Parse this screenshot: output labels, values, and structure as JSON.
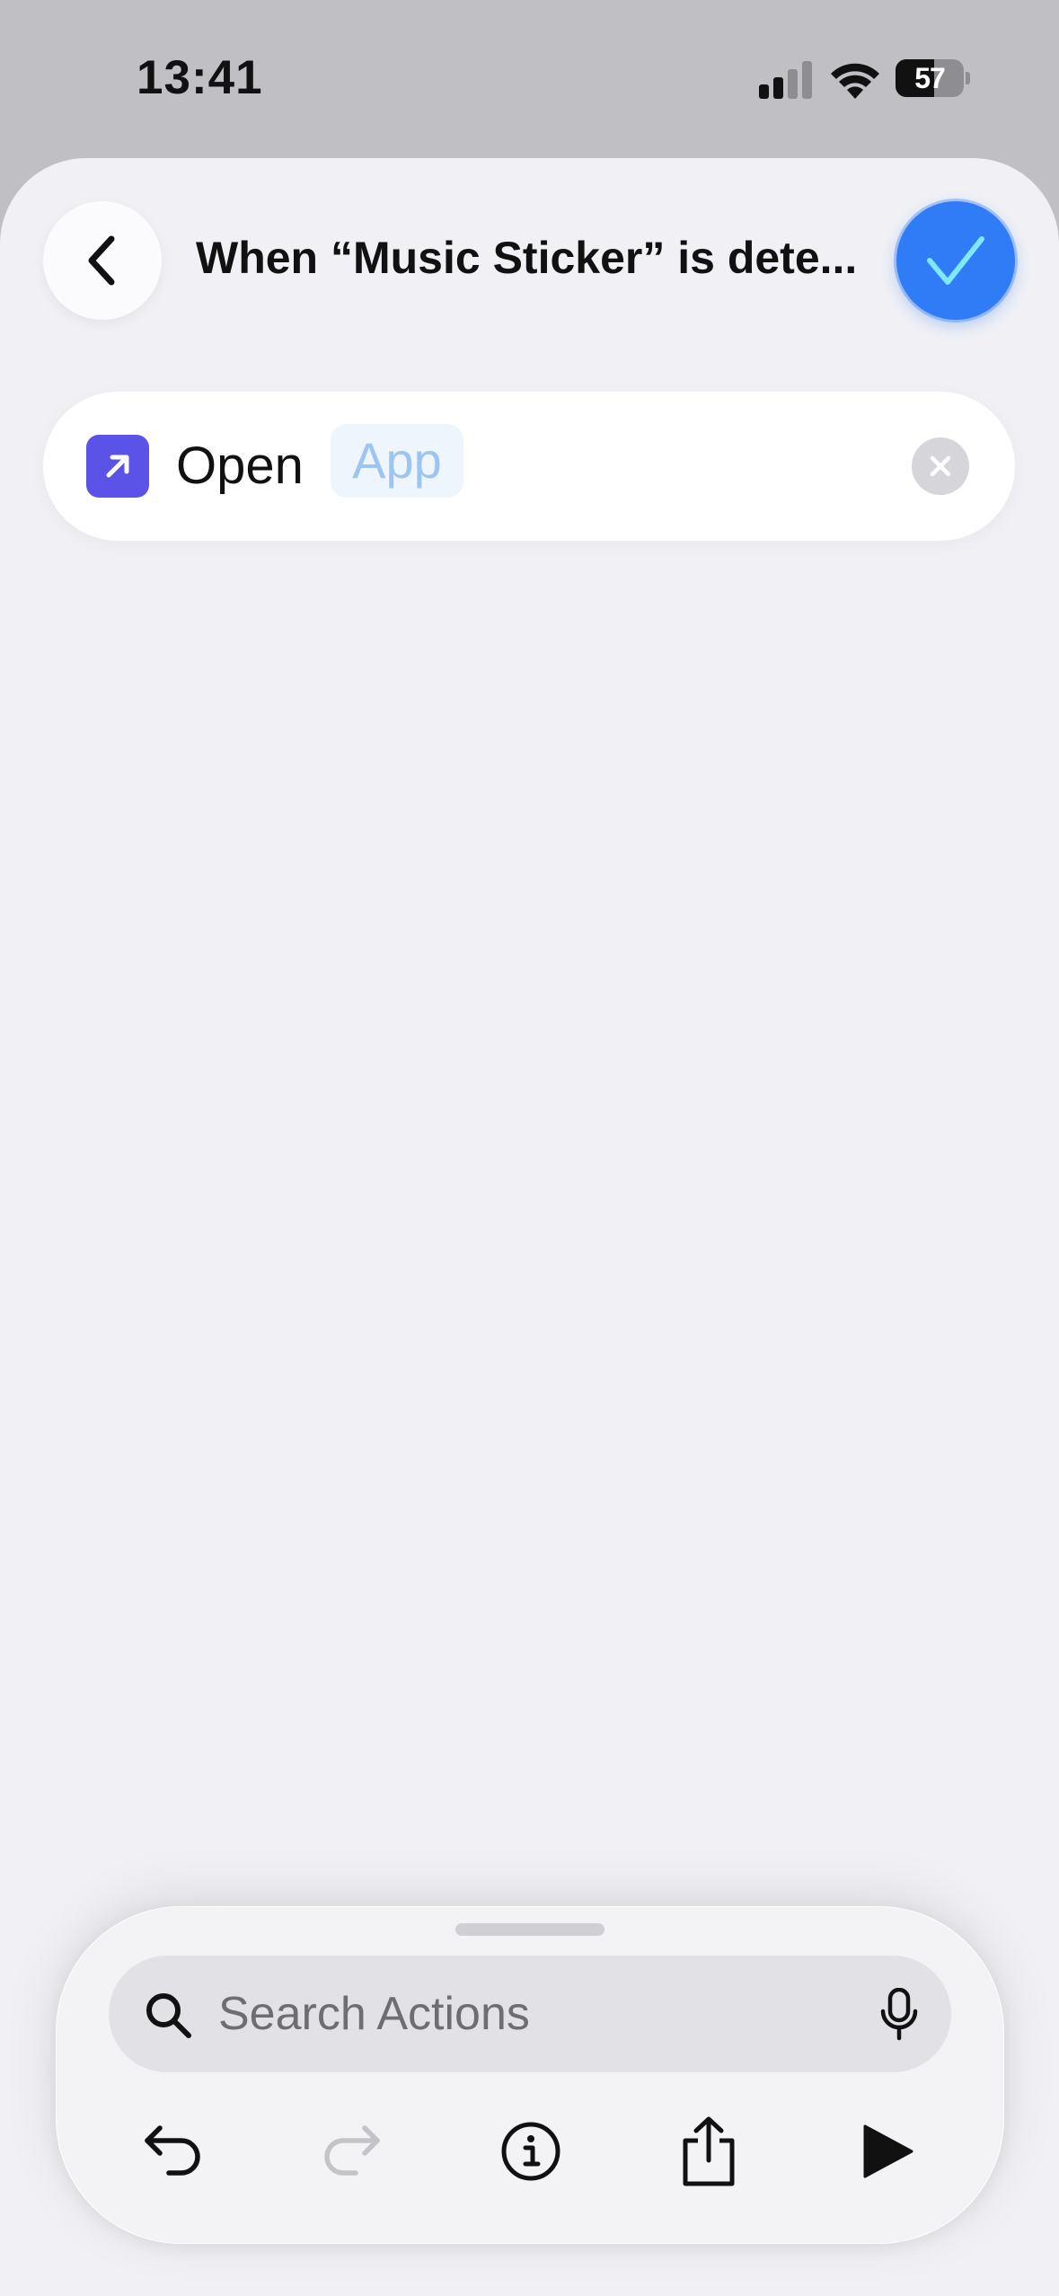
{
  "status_bar": {
    "time": "13:41",
    "battery_level": "57",
    "battery_fraction": 0.57,
    "signal_bars_active": 2,
    "signal_bars_total": 4
  },
  "header": {
    "title": "When “Music Sticker” is dete...",
    "back_icon": "chevron-left-icon",
    "done_icon": "checkmark-icon"
  },
  "action": {
    "icon": "arrow-up-right-icon",
    "verb": "Open",
    "parameter_placeholder": "App",
    "remove_icon": "xmark-circle-icon"
  },
  "search": {
    "placeholder": "Search Actions"
  },
  "toolbar": {
    "undo_icon": "undo-icon",
    "redo_icon": "redo-icon",
    "info_icon": "info-icon",
    "share_icon": "share-icon",
    "run_icon": "play-icon"
  },
  "colors": {
    "accent": "#2f7cf6",
    "action_icon": "#5b52e8",
    "parameter_text": "#9cc5f1",
    "sheet_background": "#f1f1f5"
  }
}
